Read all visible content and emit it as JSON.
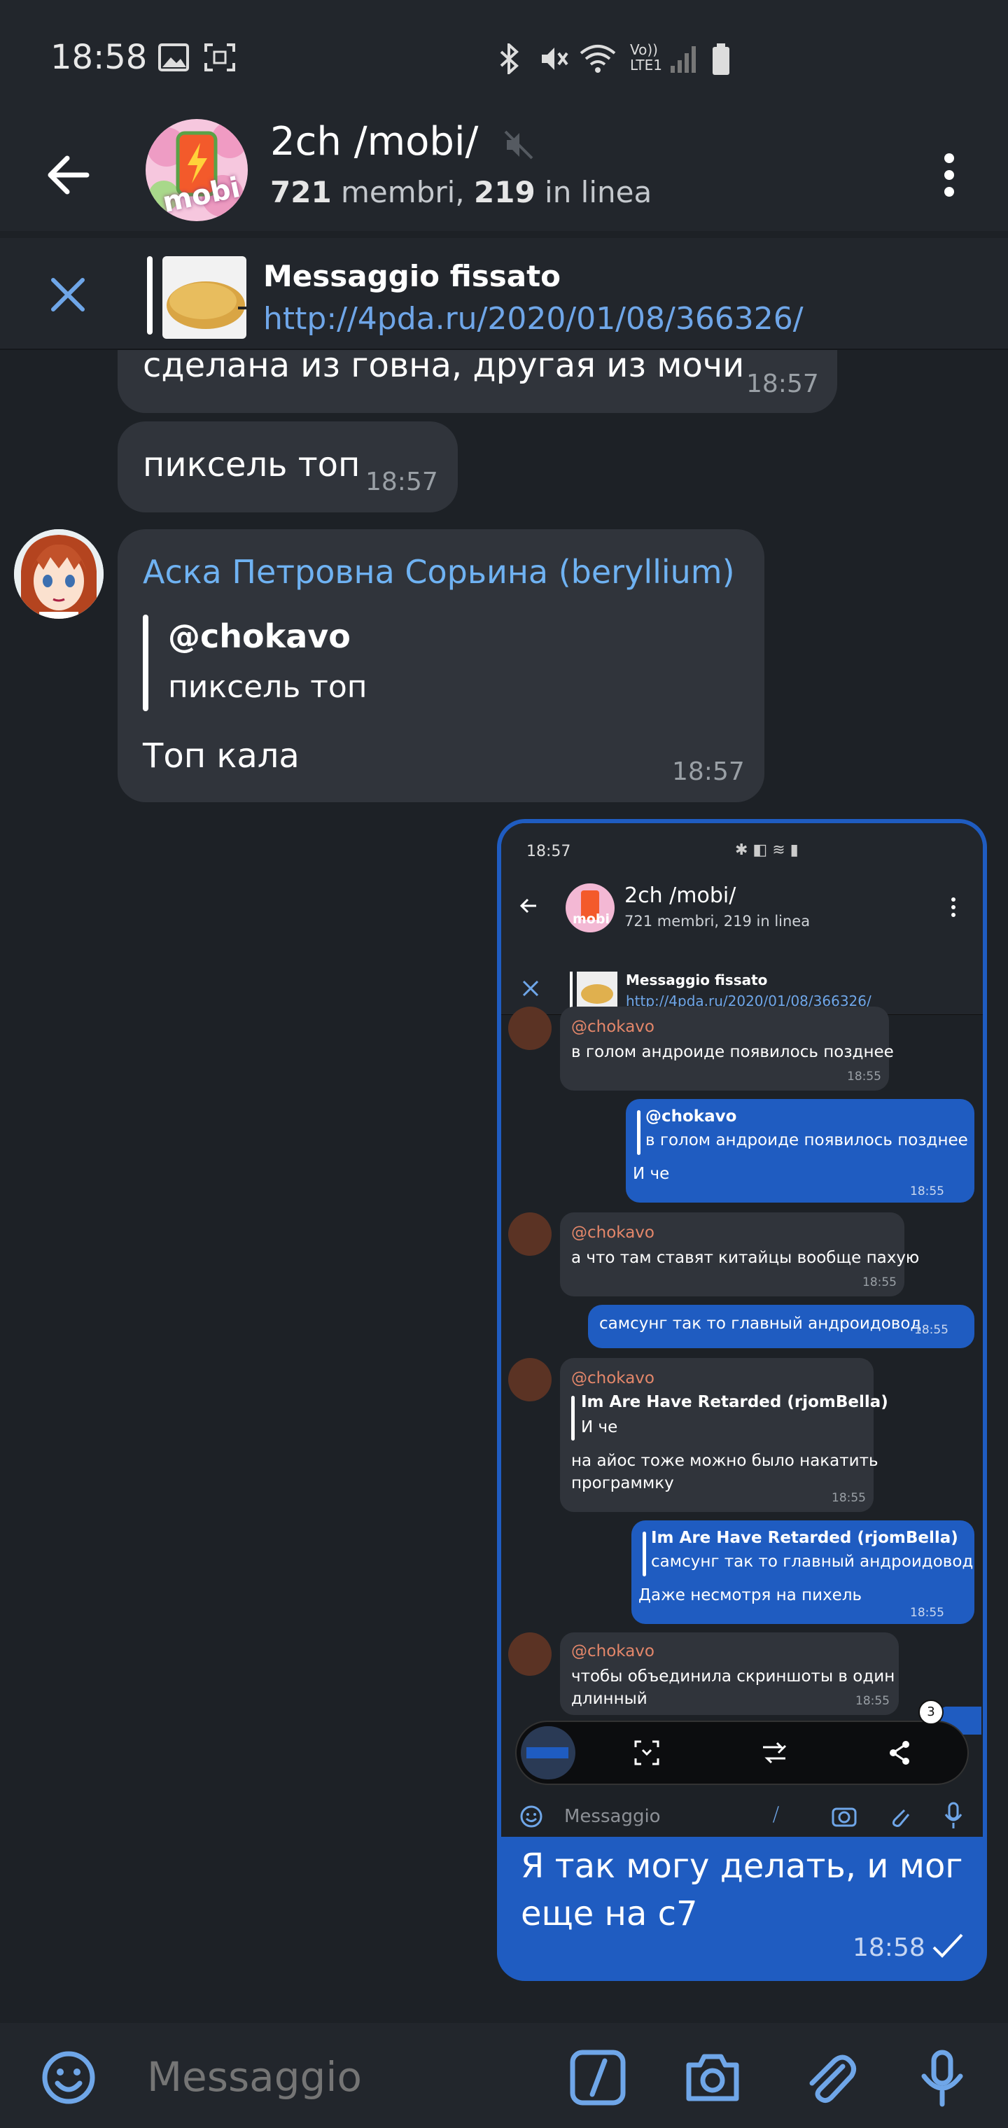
{
  "status_bar": {
    "time": "18:58",
    "network_label_1": "Vo))",
    "network_label_2": "LTE1"
  },
  "header": {
    "title": "2ch /mobi/",
    "members_count": "721",
    "members_label": " membri, ",
    "online_count": "219",
    "online_label": " in linea",
    "avatar_text": "mobi"
  },
  "pinned": {
    "label": "Messaggio fissato",
    "link": "http://4pda.ru/2020/01/08/366326/"
  },
  "messages": [
    {
      "text": "сделана из говна, другая из мочи",
      "time": "18:57"
    },
    {
      "text": "пиксель топ",
      "time": "18:57"
    },
    {
      "sender": "Аска Петровна Сорьина (beryllium)",
      "reply_name": "@chokavo",
      "reply_text": "пиксель топ",
      "text": "Топ кала",
      "time": "18:57"
    }
  ],
  "outgoing": {
    "text": "Я так могу делать, и мог еще на с7",
    "time": "18:58"
  },
  "screenshot": {
    "status_time": "18:57",
    "title": "2ch /mobi/",
    "members": "721 membri, 219 in linea",
    "avatar_text": "mobi",
    "pinned_label": "Messaggio fissato",
    "pinned_link": "http://4pda.ru/2020/01/08/366326/",
    "m1_name": "@chokavo",
    "m1_text": "в голом андроиде появилось позднее",
    "m1_time": "18:55",
    "m2_reply_name": "@chokavo",
    "m2_reply_text": "в голом андроиде появилось позднее",
    "m2_text": "И че",
    "m2_time": "18:55",
    "m3_name": "@chokavo",
    "m3_text": "а что там ставят китайцы вообще пахую",
    "m3_time": "18:55",
    "m4_text": "самсунг так то главный андроидовод",
    "m4_time": "18:55",
    "m5_name": "@chokavo",
    "m5_reply_name": "Im Are Have Retarded (rjomBella)",
    "m5_reply_text": "И че",
    "m5_text_1": "на айос тоже можно было накатить",
    "m5_text_2": "программку",
    "m5_time": "18:55",
    "m6_reply_name": "Im Are Have Retarded (rjomBella)",
    "m6_reply_text": "самсунг так то главный андроидовод",
    "m6_text": "Даже несмотря на пихель",
    "m6_time": "18:55",
    "m7_name": "@chokavo",
    "m7_text_1": "чтобы объединила скриншоты в один",
    "m7_text_2": "длинный",
    "m7_time": "18:55",
    "badge": "3",
    "input_placeholder": "Messaggio"
  },
  "input": {
    "placeholder": "Messaggio"
  },
  "colors": {
    "background": "#1d2126",
    "bar": "#22262c",
    "bubble_in": "#30343b",
    "bubble_out": "#1f5cc1",
    "accent": "#6fb2f2"
  }
}
